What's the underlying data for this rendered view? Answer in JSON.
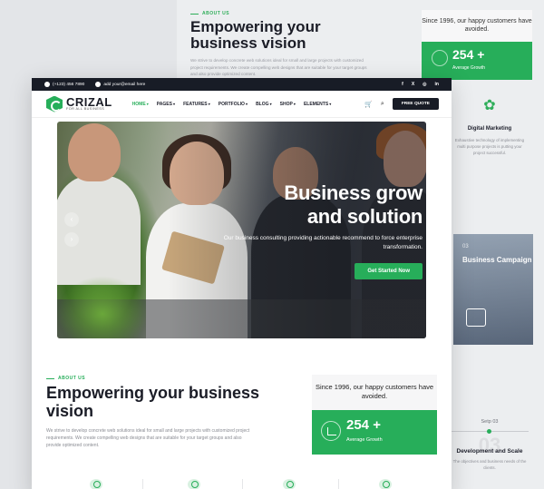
{
  "background": {
    "about": {
      "tag": "ABOUT US",
      "heading": "Empowering your business vision",
      "text": "We strive to develop concrete web solutions ideal for small and large projects with customized project requirements. We create compelling web designs that are suitable for your target groups and also provide optimized content."
    },
    "stat_card": {
      "top_text": "Since 1996, our happy customers have avoided.",
      "number": "254 +",
      "label": "Average Growth"
    },
    "service": {
      "title": "Digital Marketing",
      "text": "Exhaustive technology of implementing multi purpose projects is putting your project successful."
    },
    "campaign": {
      "number": "03",
      "title": "Business Campaign"
    },
    "step": {
      "label": "Setp 03",
      "big_number": "03",
      "title": "Development and Scale",
      "text": "The objectives and business needs of the clients."
    }
  },
  "topbar": {
    "phone": "(+123) 456 7890",
    "email": "add your@email here",
    "socials": [
      "f",
      "X",
      "◎",
      "in"
    ]
  },
  "navbar": {
    "logo_name": "CRIZAL",
    "logo_sub": "FOR ALL BUSINESS",
    "menu": [
      "HOME",
      "PAGES",
      "FEATURES",
      "PORTFOLIO",
      "BLOG",
      "SHOP",
      "ELEMENTS"
    ],
    "active_menu": "HOME",
    "cart_icon": "cart-icon",
    "search_icon": "search-icon",
    "quote_button": "FREE QUOTE"
  },
  "hero": {
    "heading_line1": "Business grow",
    "heading_line2": "and solution",
    "subtext": "Our business consulting providing actionable recommend to force enterprise transformation.",
    "cta": "Get Started Now",
    "prev_arrow": "‹",
    "next_arrow": "›"
  },
  "about": {
    "tag": "ABOUT US",
    "heading": "Empowering your business vision",
    "text": "We strive to develop concrete web solutions ideal for small and large projects with customized project requirements. We create compelling web designs that are suitable for your target groups and also provide optimized content."
  },
  "stat_card": {
    "top_text": "Since 1996, our happy customers have avoided.",
    "number": "254 +",
    "label": "Average Growth"
  },
  "colors": {
    "accent": "#27ae5a",
    "dark": "#181c26"
  }
}
